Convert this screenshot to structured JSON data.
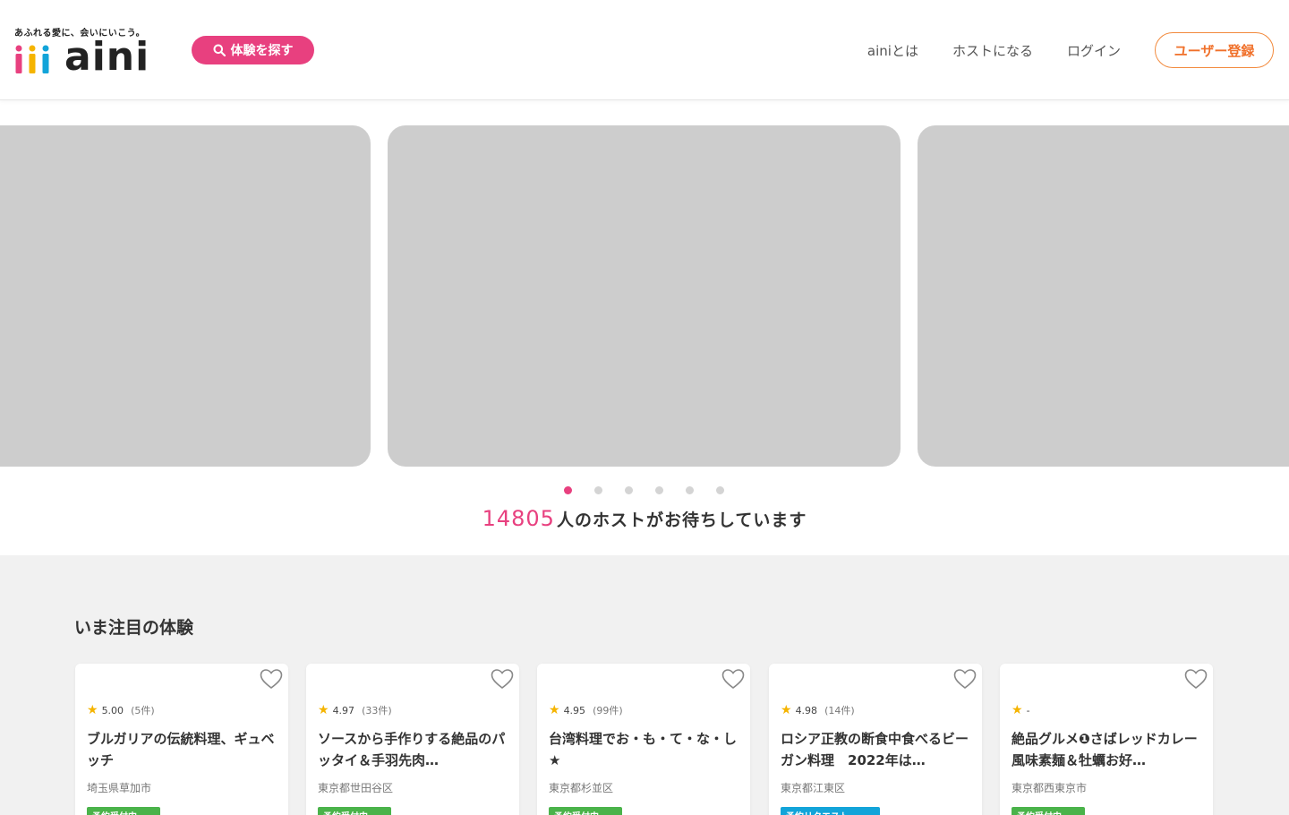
{
  "header": {
    "tagline": "あふれる愛に、会いにいこう。",
    "logo_text": "aini",
    "search_button": "体験を探す",
    "nav": [
      "ainiとは",
      "ホストになる",
      "ログイン"
    ],
    "register_button": "ユーザー登録",
    "colors": {
      "brand_pink": "#e8407f",
      "register_orange": "#f0702a"
    }
  },
  "carousel": {
    "dots": 6,
    "active_index": 0
  },
  "host_banner": {
    "count": "14805",
    "text": "人のホストがお待ちしています"
  },
  "featured": {
    "title": "いま注目の体験",
    "cards": [
      {
        "rating": "5.00",
        "count": "(5件)",
        "title": "ブルガリアの伝統料理、ギュベッチ",
        "location": "埼玉県草加市",
        "badge": "予約受付中"
      },
      {
        "rating": "4.97",
        "count": "(33件)",
        "title": "ソースから手作りする絶品のパッタイ＆手羽先肉…",
        "location": "東京都世田谷区",
        "badge": "予約受付中"
      },
      {
        "rating": "4.95",
        "count": "(99件)",
        "title": "台湾料理でお・も・て・な・し★",
        "location": "東京都杉並区",
        "badge": "予約受付中"
      },
      {
        "rating": "4.98",
        "count": "(14件)",
        "title": "ロシア正教の断食中食べるビーガン料理　2022年は…",
        "location": "東京都江東区",
        "badge": "予約リクエスト"
      },
      {
        "rating": "-",
        "count": "",
        "title": "絶品グルメ❶さばレッドカレー風味素麺＆牡蠣お好…",
        "location": "東京都西東京市",
        "badge": "予約受付中"
      }
    ]
  }
}
